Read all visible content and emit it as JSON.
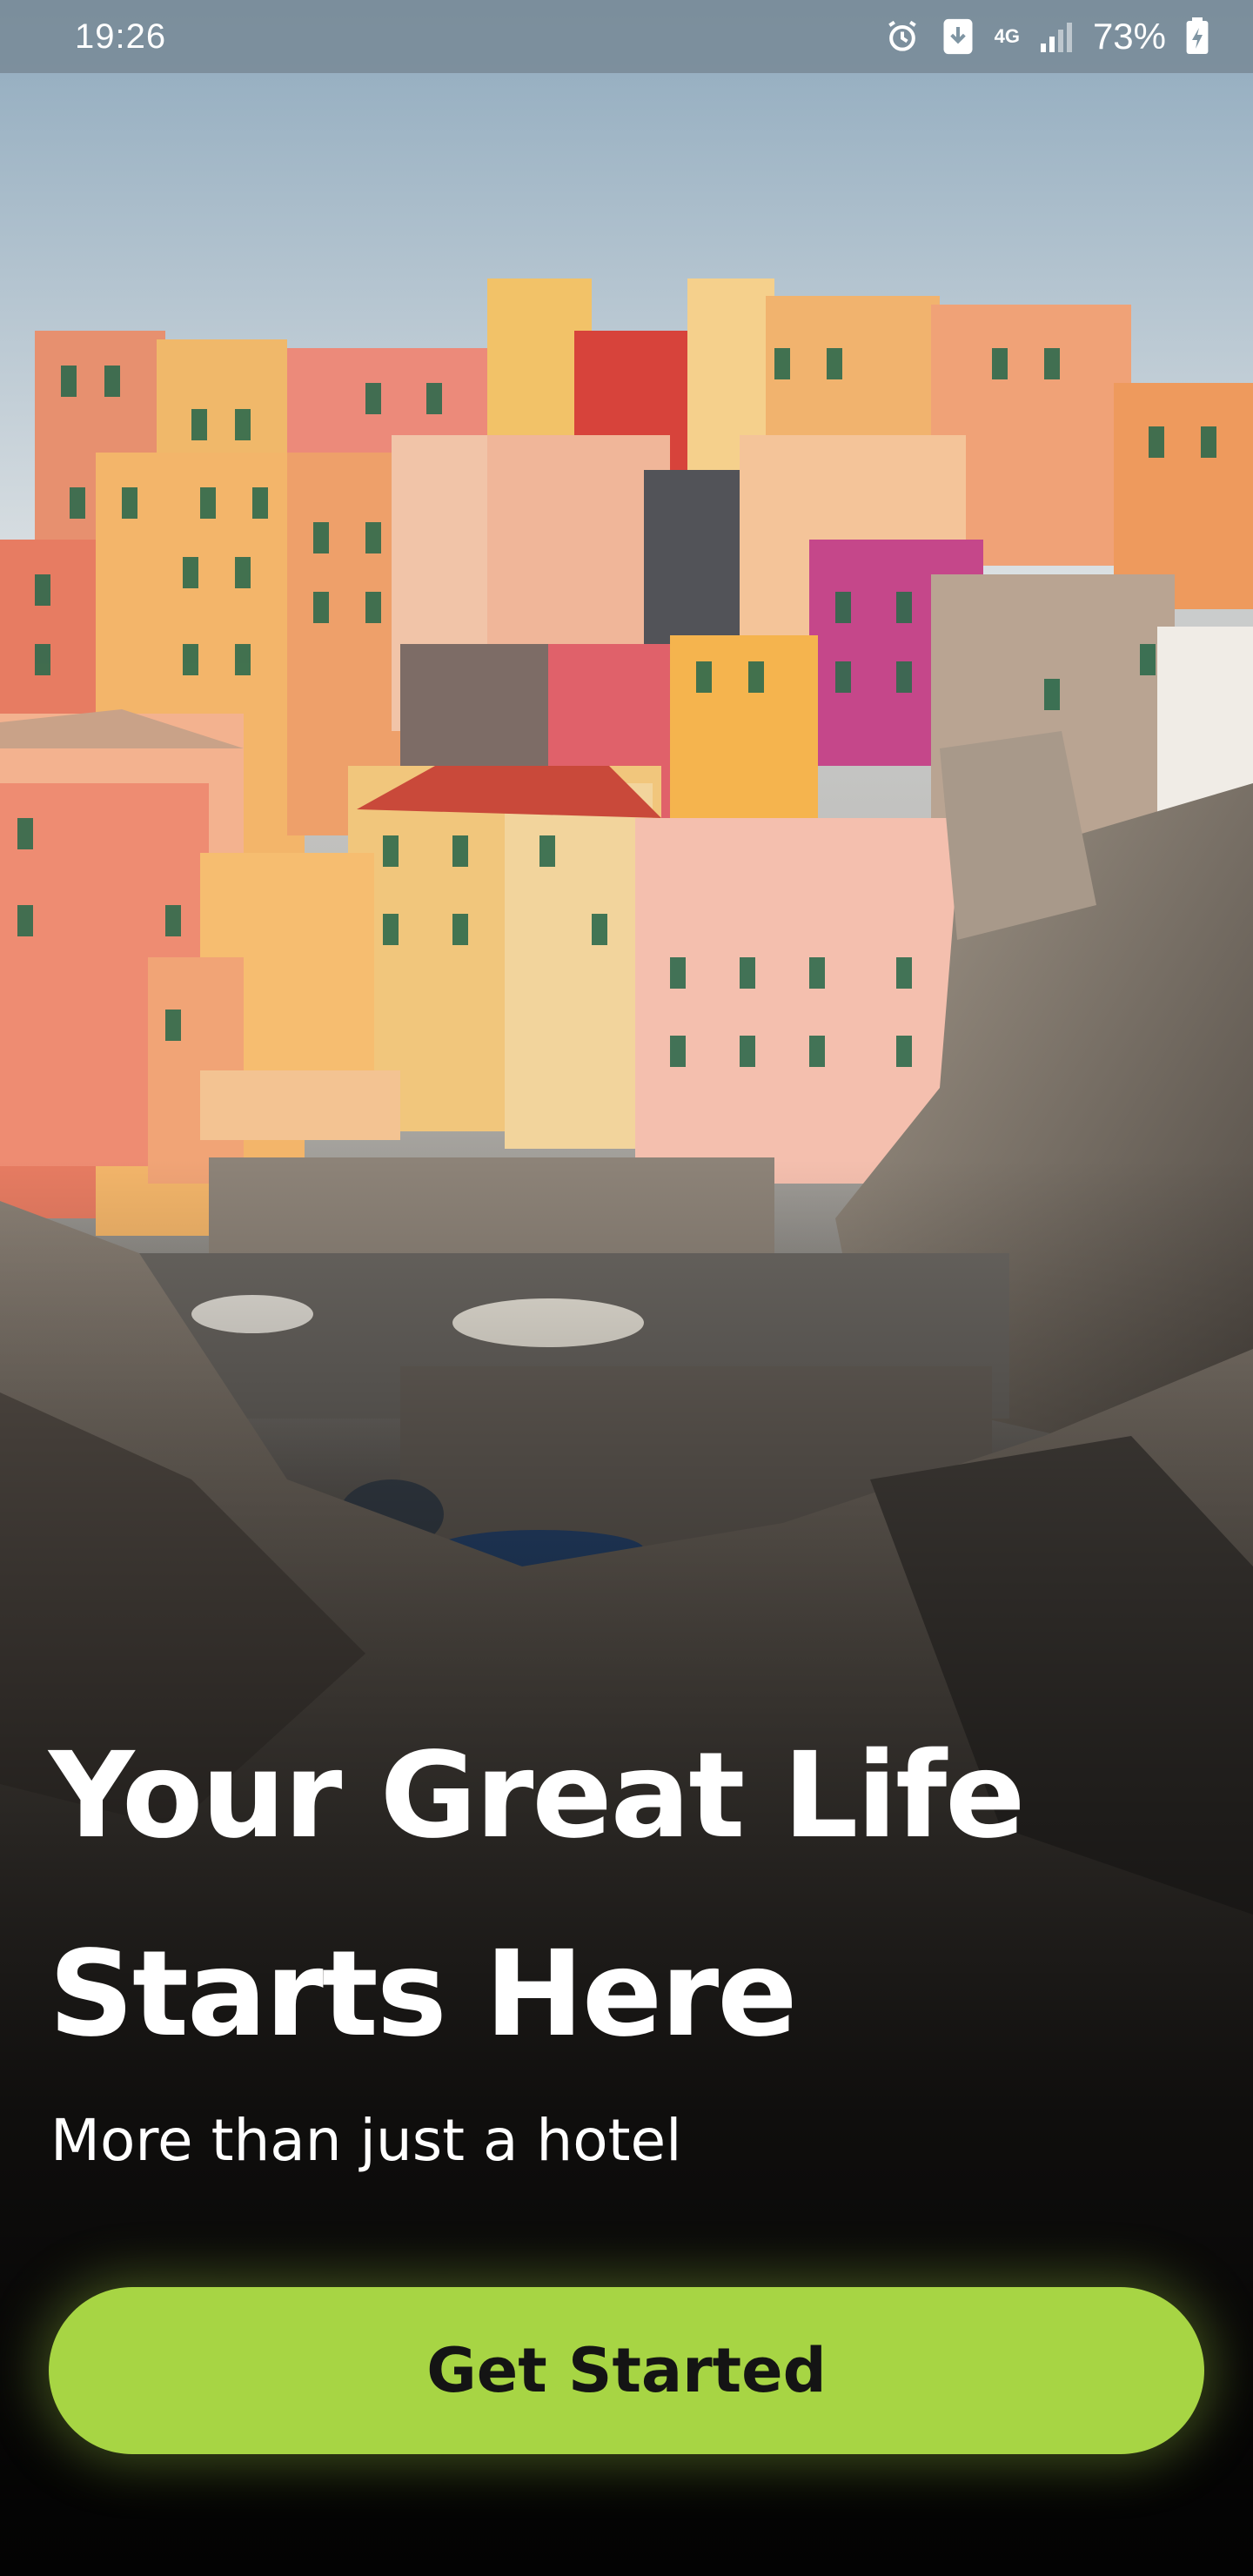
{
  "status_bar": {
    "time": "19:26",
    "network": "4G",
    "battery_percent": "73%",
    "icons": [
      "alarm-icon",
      "download-icon",
      "signal-icon",
      "battery-charging-icon"
    ]
  },
  "hero": {
    "title_line1": "Your Great Life",
    "title_line2": "Starts Here",
    "subtitle": "More than just a hotel",
    "cta_label": "Get Started"
  },
  "colors": {
    "accent": "#a7d544",
    "title_text": "#ffffff",
    "button_text": "#141414"
  },
  "background": {
    "scene": "colorful cliffside village over rocky harbor"
  }
}
